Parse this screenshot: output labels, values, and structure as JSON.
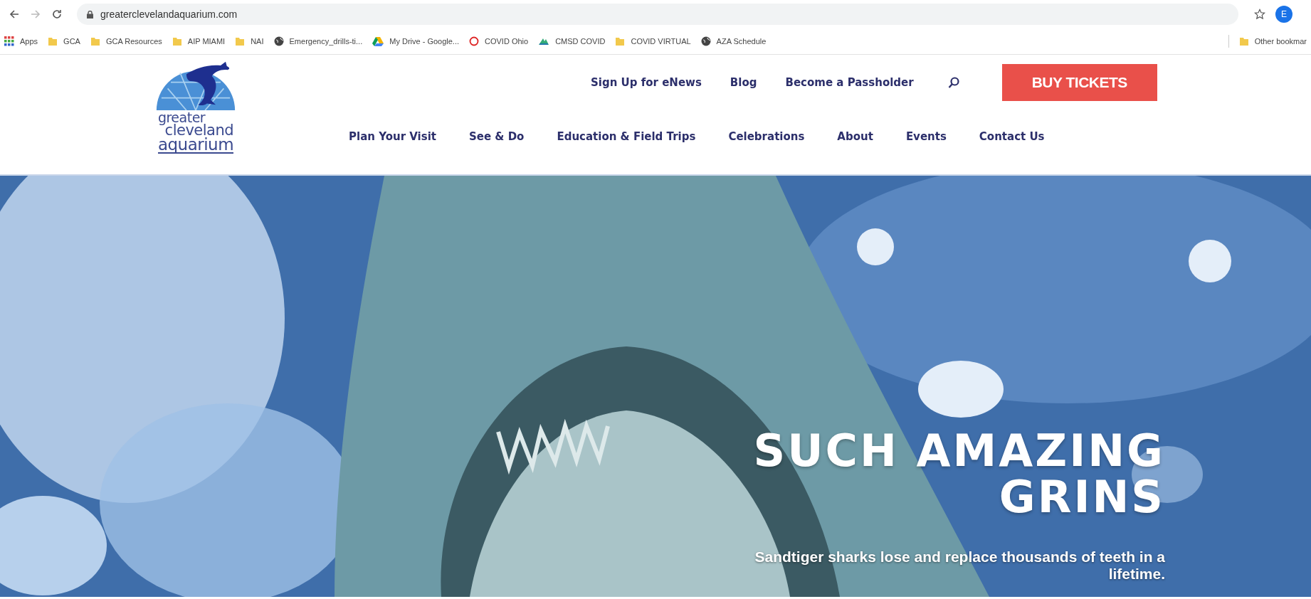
{
  "browser": {
    "url": "greaterclevelandaquarium.com",
    "profile_initial": "E"
  },
  "bookmarks": [
    {
      "label": "Apps",
      "kind": "apps"
    },
    {
      "label": "GCA",
      "kind": "folder"
    },
    {
      "label": "GCA Resources",
      "kind": "folder"
    },
    {
      "label": "AIP MIAMI",
      "kind": "folder"
    },
    {
      "label": "NAI",
      "kind": "folder"
    },
    {
      "label": "Emergency_drills-ti...",
      "kind": "globe"
    },
    {
      "label": "My Drive - Google...",
      "kind": "drive"
    },
    {
      "label": "COVID Ohio",
      "kind": "ring"
    },
    {
      "label": "CMSD COVID",
      "kind": "site"
    },
    {
      "label": "COVID VIRTUAL",
      "kind": "folder"
    },
    {
      "label": "AZA Schedule",
      "kind": "globe"
    }
  ],
  "other_bookmarks": {
    "label": "Other bookmar",
    "kind": "folder"
  },
  "site": {
    "logo": [
      "greater",
      "cleveland",
      "aquarium"
    ],
    "utility_links": [
      "Sign Up for eNews",
      "Blog",
      "Become a Passholder"
    ],
    "cta": "BUY TICKETS",
    "nav": [
      "Plan Your Visit",
      "See & Do",
      "Education & Field Trips",
      "Celebrations",
      "About",
      "Events",
      "Contact Us"
    ]
  },
  "hero": {
    "kind": "picture",
    "title": [
      "SUCH AMAZING",
      "GRINS"
    ],
    "caption": "Sandtiger sharks lose and replace thousands of teeth in a lifetime."
  }
}
